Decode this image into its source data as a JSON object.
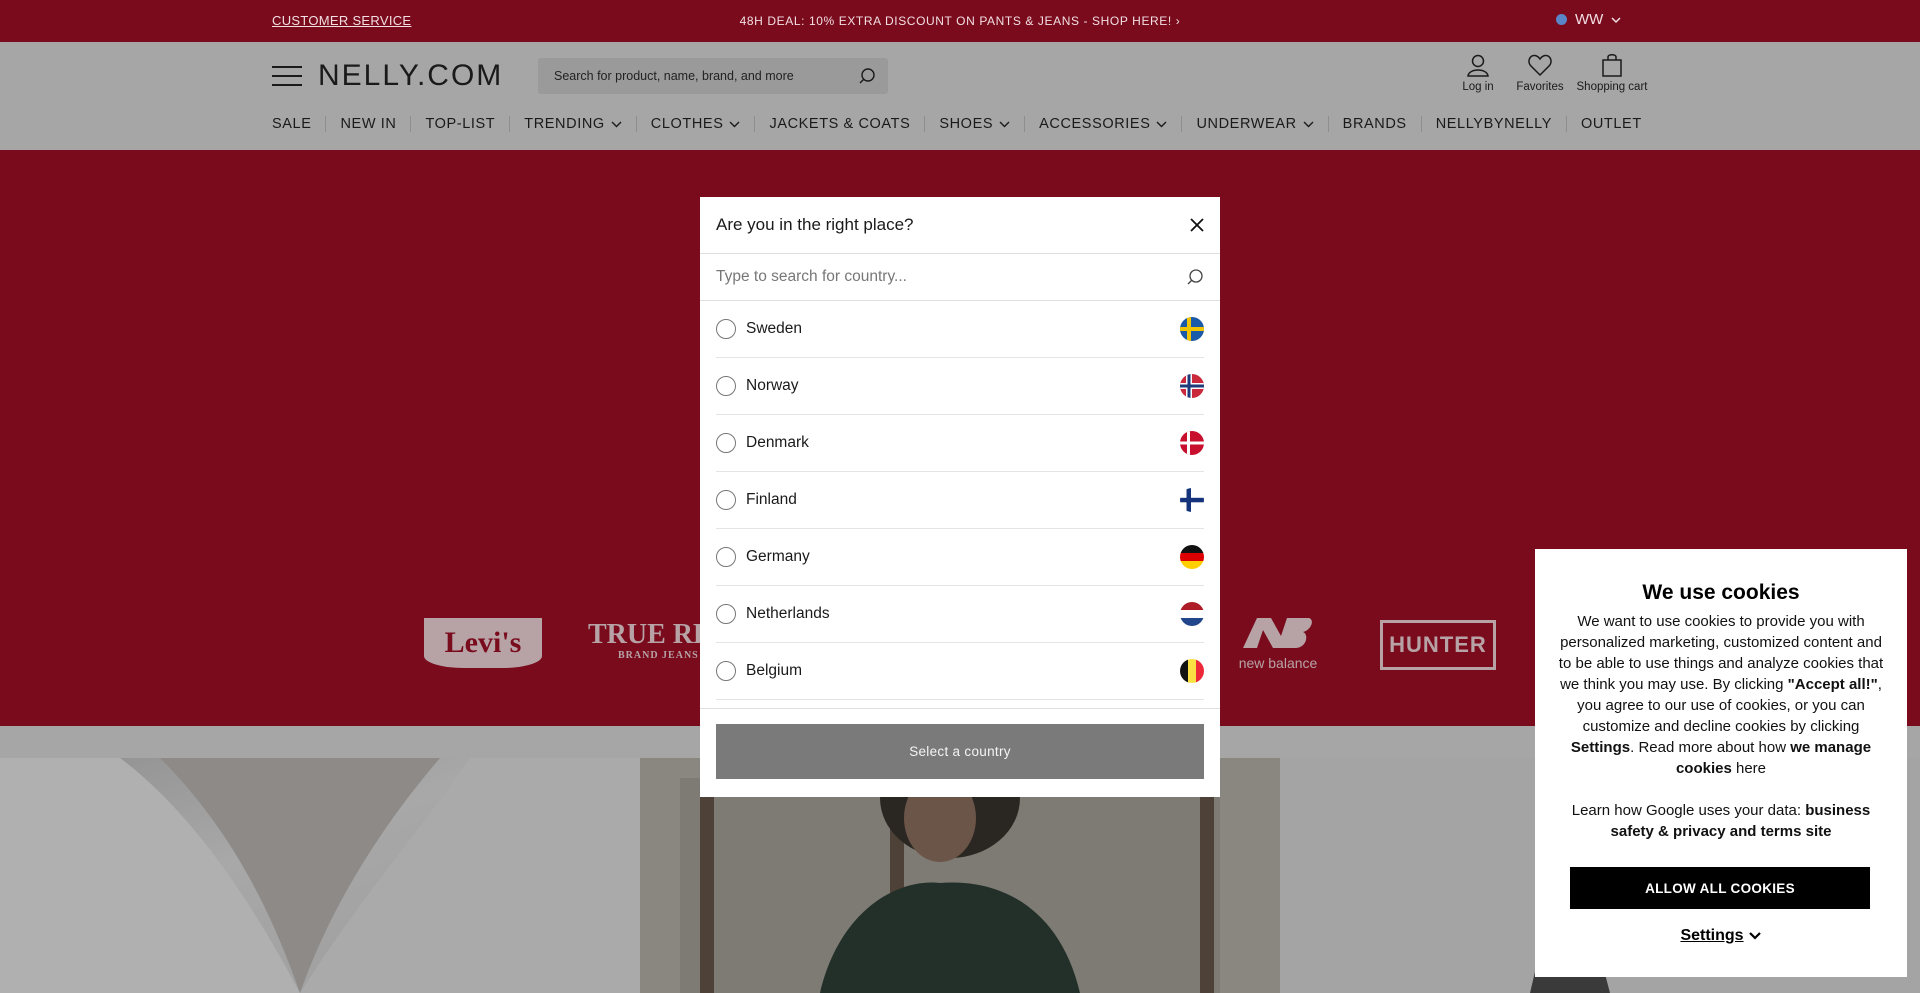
{
  "topbar": {
    "customer_service": "CUSTOMER SERVICE",
    "promo": "48H DEAL: 10% EXTRA DISCOUNT ON PANTS & JEANS - SHOP HERE! ›",
    "region": "WW",
    "region_icon": "globe-icon",
    "bg_color": "#790b1d"
  },
  "header": {
    "logo": "NELLY.COM",
    "search_placeholder": "Search for product, name, brand, and more",
    "login": "Log in",
    "favorites": "Favorites",
    "cart": "Shopping cart"
  },
  "nav": [
    {
      "label": "SALE",
      "dropdown": false
    },
    {
      "label": "NEW IN",
      "dropdown": false
    },
    {
      "label": "TOP-LIST",
      "dropdown": false
    },
    {
      "label": "TRENDING",
      "dropdown": true
    },
    {
      "label": "CLOTHES",
      "dropdown": true
    },
    {
      "label": "JACKETS & COATS",
      "dropdown": false
    },
    {
      "label": "SHOES",
      "dropdown": true
    },
    {
      "label": "ACCESSORIES",
      "dropdown": true
    },
    {
      "label": "UNDERWEAR",
      "dropdown": true
    },
    {
      "label": "BRANDS",
      "dropdown": false
    },
    {
      "label": "NELLYBYNELLY",
      "dropdown": false
    },
    {
      "label": "OUTLET",
      "dropdown": false
    }
  ],
  "hero": {
    "brands": [
      "Levi's",
      "TRUE RELIGION",
      "new balance",
      "HUNTER"
    ],
    "true_religion_sub": "BRAND JEANS"
  },
  "modal": {
    "title": "Are you in the right place?",
    "search_placeholder": "Type to search for country...",
    "countries": [
      {
        "name": "Sweden",
        "flag": "flag-sweden"
      },
      {
        "name": "Norway",
        "flag": "flag-norway"
      },
      {
        "name": "Denmark",
        "flag": "flag-denmark"
      },
      {
        "name": "Finland",
        "flag": "flag-finland"
      },
      {
        "name": "Germany",
        "flag": "flag-germany"
      },
      {
        "name": "Netherlands",
        "flag": "flag-netherlands"
      },
      {
        "name": "Belgium",
        "flag": "flag-belgium"
      }
    ],
    "button": "Select a country"
  },
  "cookies": {
    "title": "We use cookies",
    "p1_a": "We want to use cookies to provide you with personalized marketing, customized content and to be able to use things and analyze cookies that we think you may use. By clicking ",
    "p1_accept": "\"Accept all!\"",
    "p1_b": ", you agree to our use of cookies, or you can customize and decline cookies by clicking ",
    "p1_settings": "Settings",
    "p1_c": ". Read more about how ",
    "p1_link": "we manage cookies",
    "p1_d": " here",
    "p2_a": "Learn how Google uses your data: ",
    "p2_link": "business safety & privacy and terms site",
    "allow_button": "ALLOW ALL COOKIES",
    "settings": "Settings"
  }
}
